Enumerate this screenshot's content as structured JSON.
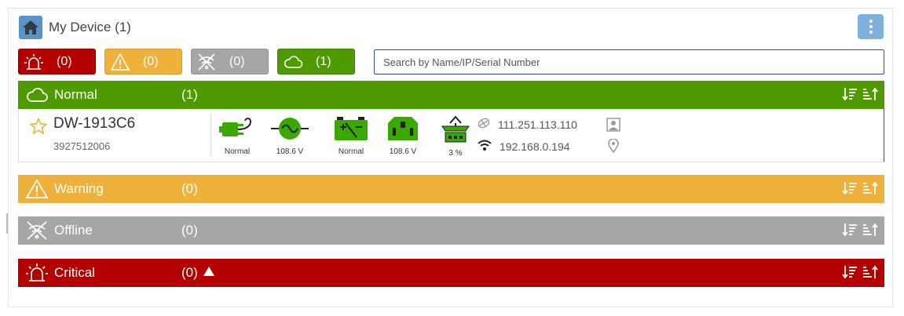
{
  "header": {
    "title": "My Device (1)"
  },
  "filters": [
    {
      "key": "critical",
      "icon": "siren-icon",
      "count": "(0)"
    },
    {
      "key": "warning",
      "icon": "warning-triangle-icon",
      "count": "(0)"
    },
    {
      "key": "offline",
      "icon": "offline-icon",
      "count": "(0)"
    },
    {
      "key": "normal",
      "icon": "cloud-icon",
      "count": "(1)"
    }
  ],
  "search": {
    "placeholder": "Search by Name/IP/Serial Number",
    "value": ""
  },
  "groups": {
    "normal": {
      "label": "Normal",
      "count": "(1)",
      "color": "#4f9a00"
    },
    "warning": {
      "label": "Warning",
      "count": "(0)",
      "color": "#eeb23c"
    },
    "offline": {
      "label": "Offline",
      "count": "(0)",
      "color": "#a6a6a6"
    },
    "critical": {
      "label": "Critical",
      "count": "(0)",
      "color": "#b50000"
    }
  },
  "device": {
    "name": "DW-1913C6",
    "serial": "3927512006",
    "metrics": [
      {
        "icon": "power-plug-icon",
        "label": "Normal"
      },
      {
        "icon": "ac-input-icon",
        "label": "108.6 V"
      },
      {
        "icon": "battery-icon",
        "label": "Normal"
      },
      {
        "icon": "outlet-icon",
        "label": "108.6 V"
      },
      {
        "icon": "load-icon",
        "label": "3 %"
      }
    ],
    "wan_ip": "111.251.113.110",
    "lan_ip": "192.168.0.194"
  },
  "colors": {
    "accent_green": "#3aa800",
    "icon_grey": "#9a9a9a"
  }
}
